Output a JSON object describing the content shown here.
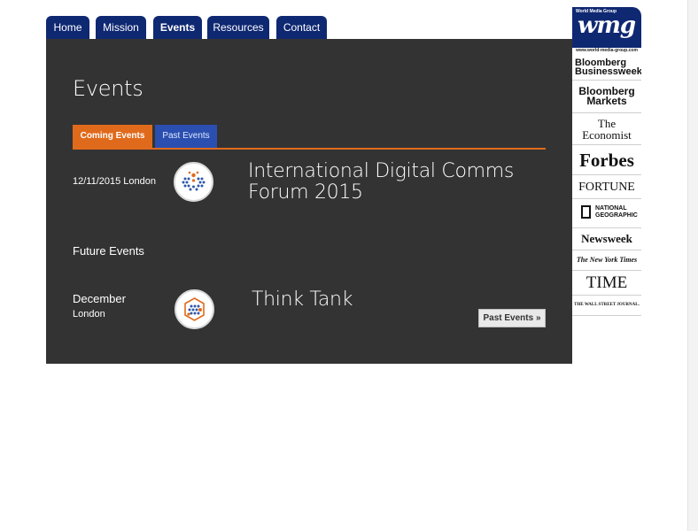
{
  "nav": {
    "tabs": [
      {
        "label": "Home"
      },
      {
        "label": "Mission"
      },
      {
        "label": "Events"
      },
      {
        "label": "Resources"
      },
      {
        "label": "Contact"
      }
    ],
    "active": "Events"
  },
  "page": {
    "title": "Events",
    "tabs": {
      "coming": "Coming Events",
      "past": "Past Events"
    },
    "section_heading": "Future Events",
    "past_button": "Past Events »"
  },
  "events": [
    {
      "date": "12/11/2015 London",
      "title_line1": "International Digital Comms",
      "title_line2": "Forum 2015"
    },
    {
      "date_line1": "December",
      "date_line2": "London",
      "title": "Think Tank"
    }
  ],
  "sidebar": {
    "brand_top": "World Media Group",
    "brand_logo": "wmg",
    "brand_url": "www.world-media-group.com",
    "publications": [
      {
        "line1": "Bloomberg",
        "line2": "Businessweek"
      },
      {
        "line1": "Bloomberg",
        "line2": "Markets"
      },
      {
        "line1": "The",
        "line2": "Economist"
      },
      {
        "line1": "Forbes"
      },
      {
        "line1": "FORTUNE"
      },
      {
        "line1": "NATIONAL",
        "line2": "GEOGRAPHIC"
      },
      {
        "line1": "Newsweek"
      },
      {
        "line1": "The New York Times"
      },
      {
        "line1": "TIME"
      },
      {
        "line1": "THE WALL STREET JOURNAL."
      }
    ]
  },
  "colors": {
    "nav": "#0f2872",
    "panel": "#333333",
    "accent_orange": "#e06a1b",
    "past_tab": "#2b4fb0"
  }
}
